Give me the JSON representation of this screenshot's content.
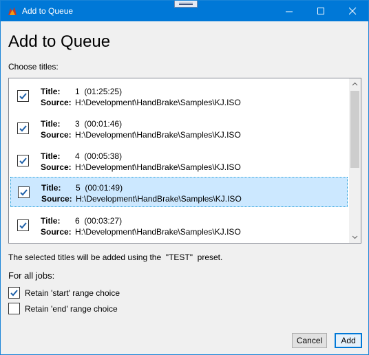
{
  "window": {
    "title": "Add to Queue"
  },
  "heading": "Add to Queue",
  "choose_label": "Choose titles:",
  "titles": [
    {
      "label": "Title:",
      "number": "1",
      "duration": "(01:25:25)",
      "source_label": "Source:",
      "source": "H:\\Development\\HandBrake\\Samples\\KJ.ISO",
      "checked": true,
      "selected": false
    },
    {
      "label": "Title:",
      "number": "3",
      "duration": "(00:01:46)",
      "source_label": "Source:",
      "source": "H:\\Development\\HandBrake\\Samples\\KJ.ISO",
      "checked": true,
      "selected": false
    },
    {
      "label": "Title:",
      "number": "4",
      "duration": "(00:05:38)",
      "source_label": "Source:",
      "source": "H:\\Development\\HandBrake\\Samples\\KJ.ISO",
      "checked": true,
      "selected": false
    },
    {
      "label": "Title:",
      "number": "5",
      "duration": "(00:01:49)",
      "source_label": "Source:",
      "source": "H:\\Development\\HandBrake\\Samples\\KJ.ISO",
      "checked": true,
      "selected": true
    },
    {
      "label": "Title:",
      "number": "6",
      "duration": "(00:03:27)",
      "source_label": "Source:",
      "source": "H:\\Development\\HandBrake\\Samples\\KJ.ISO",
      "checked": true,
      "selected": false
    }
  ],
  "preset_text": "The selected titles will be added using the  \"TEST\"  preset.",
  "for_all_jobs": "For all jobs:",
  "options": {
    "retain_start": {
      "label": "Retain 'start' range choice",
      "checked": true
    },
    "retain_end": {
      "label": "Retain 'end' range choice",
      "checked": false
    }
  },
  "buttons": {
    "cancel": "Cancel",
    "add": "Add"
  },
  "colors": {
    "titlebar": "#0078d7",
    "selection": "#cce8ff",
    "check": "#1c5fa8"
  }
}
